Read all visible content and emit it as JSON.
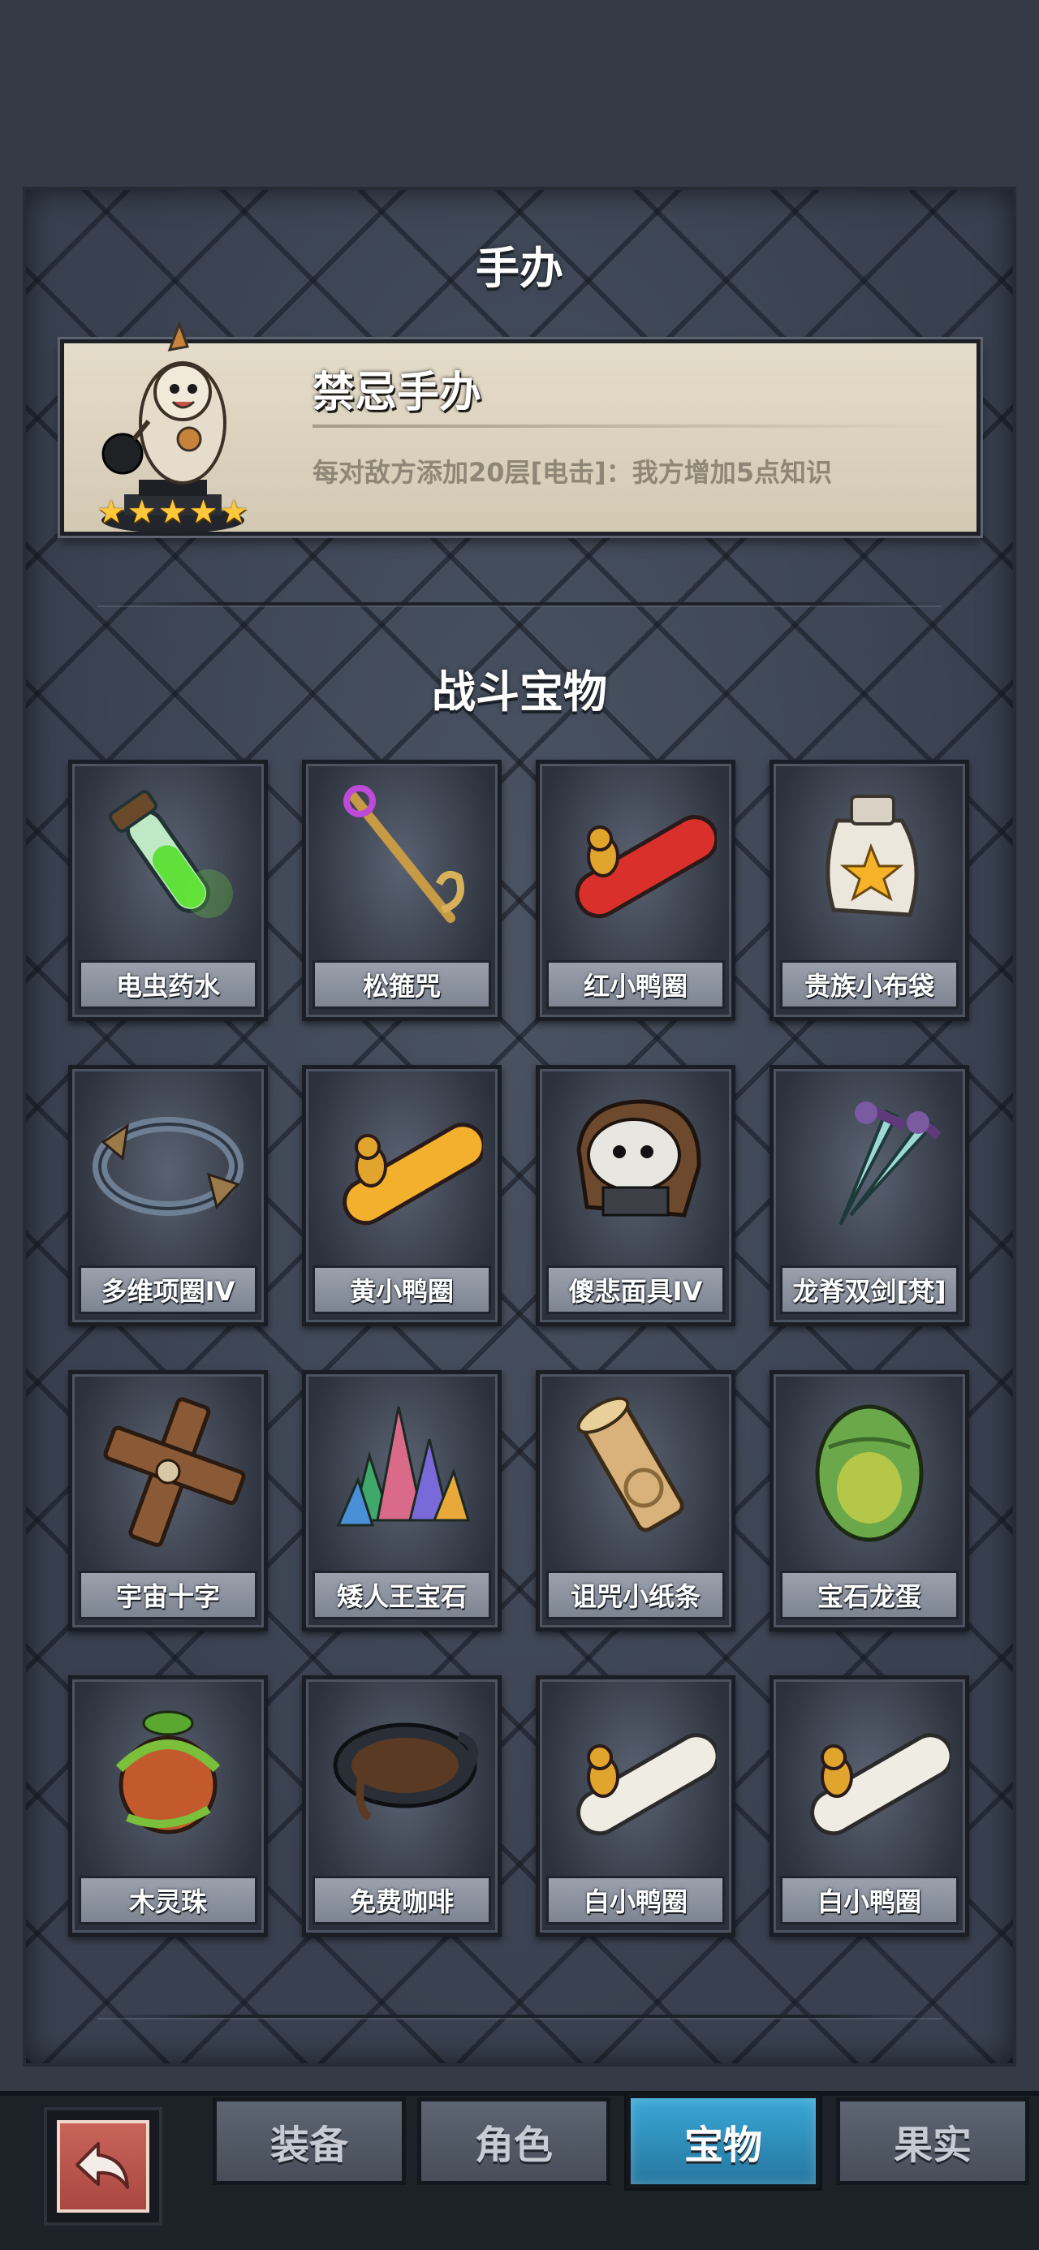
{
  "figure_section": {
    "title": "手办",
    "name": "禁忌手办",
    "description": "每对敌方添加20层[电击]：我方增加5点知识",
    "stars": 5,
    "star_glyph": "★"
  },
  "treasure_section": {
    "title": "战斗宝物",
    "items": [
      {
        "label": "电虫药水",
        "icon": "green-potion-icon"
      },
      {
        "label": "松箍咒",
        "icon": "staff-icon"
      },
      {
        "label": "红小鸭圈",
        "icon": "red-duck-ring-icon"
      },
      {
        "label": "贵族小布袋",
        "icon": "cloth-bag-icon"
      },
      {
        "label": "多维项圈IV",
        "icon": "collar-icon"
      },
      {
        "label": "黄小鸭圈",
        "icon": "yellow-duck-ring-icon"
      },
      {
        "label": "傻悲面具IV",
        "icon": "mask-icon"
      },
      {
        "label": "龙脊双剑[梵]",
        "icon": "twin-swords-icon"
      },
      {
        "label": "宇宙十字",
        "icon": "wooden-cross-icon"
      },
      {
        "label": "矮人王宝石",
        "icon": "gem-cluster-icon"
      },
      {
        "label": "诅咒小纸条",
        "icon": "scroll-icon"
      },
      {
        "label": "宝石龙蛋",
        "icon": "dragon-egg-icon"
      },
      {
        "label": "木灵珠",
        "icon": "wood-orb-icon"
      },
      {
        "label": "免费咖啡",
        "icon": "coffee-cup-icon"
      },
      {
        "label": "白小鸭圈",
        "icon": "white-duck-ring-icon"
      },
      {
        "label": "白小鸭圈",
        "icon": "white-duck-ring-icon"
      }
    ]
  },
  "bottom_nav": {
    "back_icon": "back-arrow-icon",
    "tabs": [
      {
        "label": "装备",
        "active": false
      },
      {
        "label": "角色",
        "active": false
      },
      {
        "label": "宝物",
        "active": true
      },
      {
        "label": "果实",
        "active": false
      }
    ]
  },
  "colors": {
    "active_tab": "#2f93c2",
    "star": "#ffc83a",
    "card_bg": "#ddd4bf"
  }
}
